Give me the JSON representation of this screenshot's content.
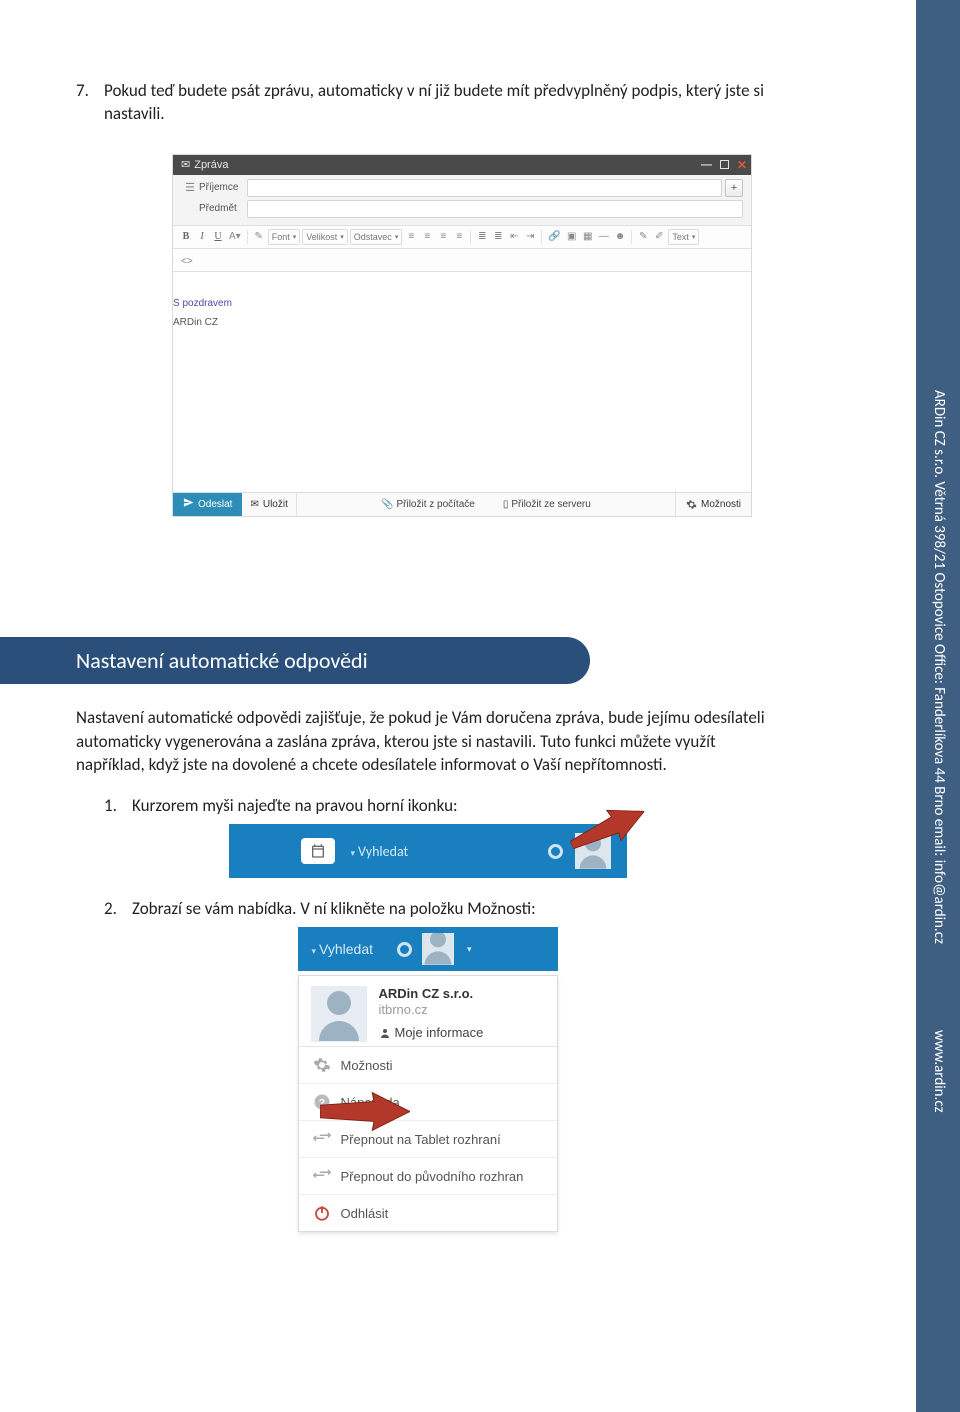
{
  "doc": {
    "item7": {
      "num": "7.",
      "text": "Pokud teď budete psát zprávu, automaticky v ní již budete mít předvyplněný podpis, který jste si nastavili."
    },
    "heading": "Nastavení automatické odpovědi",
    "para": "Nastavení automatické odpovědi zajišťuje, že pokud je Vám doručena zpráva, bude jejímu odesílateli automaticky vygenerována a zaslána zpráva, kterou jste si nastavili. Tuto funkci můžete využít například, když jste na dovolené a chcete odesílatele informovat o Vaší nepřítomnosti.",
    "step1": {
      "num": "1.",
      "text": "Kurzorem myši najeďte na pravou horní ikonku:"
    },
    "step2": {
      "num": "2.",
      "text": "Zobrazí se vám nabídka. V ní klikněte na položku Možnosti:"
    }
  },
  "sidebar": {
    "line1": "ARDin CZ s.r.o.  Větrná 398/21 Ostopovice Office: Fanderlíkova 44 Brno email: info@ardin.cz",
    "line2": "www.ardin.cz"
  },
  "compose": {
    "title": "Zpráva",
    "recipient_label": "Příjemce",
    "subject_label": "Předmět",
    "toolbar": {
      "bold": "B",
      "italic": "I",
      "underline": "U",
      "font": "Font",
      "size": "Velikost",
      "para": "Odstavec",
      "text": "Text"
    },
    "signature": {
      "l1": "S pozdravem",
      "l2": "ARDin CZ"
    },
    "footer": {
      "send": "Odeslat",
      "save": "Uložit",
      "attach_pc": "Přiložit z počítače",
      "attach_srv": "Přiložit ze serveru",
      "options": "Možnosti"
    }
  },
  "topbar": {
    "search": "Vyhledat"
  },
  "menu": {
    "search": "Vyhledat",
    "user_name": "ARDin CZ s.r.o.",
    "user_domain": "itbrno.cz",
    "my_info": "Moje informace",
    "options": "Možnosti",
    "help": "Nápověda",
    "switch_tablet": "Přepnout na Tablet rozhraní",
    "switch_orig": "Přepnout do původního rozhran",
    "logout": "Odhlásit"
  }
}
